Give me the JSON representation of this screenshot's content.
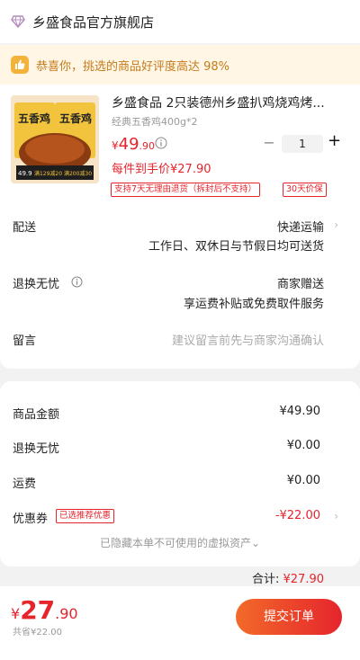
{
  "store": {
    "name": "乡盛食品官方旗舰店"
  },
  "banner": {
    "text": "恭喜你，挑选的商品好评度高达 98%"
  },
  "product": {
    "title": "乡盛食品 2只装德州乡盛扒鸡烧鸡烤...",
    "spec": "经典五香鸡400g*2",
    "price_symbol": "¥",
    "price_int": "49",
    "price_dec": ".90",
    "quantity": "1",
    "unit_price": "每件到手价¥27.90",
    "tags": [
      "支持7天无理由退货（拆封后不支持）",
      "30天价保"
    ],
    "image_text": {
      "left": "五香鸡",
      "right": "五香鸡",
      "promo": "满129减20 满200减30",
      "price": "49.9"
    }
  },
  "delivery": {
    "label": "配送",
    "method": "快递运输",
    "detail": "工作日、双休日与节假日均可送货"
  },
  "return": {
    "label": "退换无忧",
    "value": "商家赠送",
    "detail": "享运费补贴或免费取件服务"
  },
  "remark": {
    "label": "留言",
    "placeholder": "建议留言前先与商家沟通确认"
  },
  "summary": {
    "rows": [
      {
        "label": "商品金额",
        "value": "¥49.90"
      },
      {
        "label": "退换无忧",
        "value": "¥0.00"
      },
      {
        "label": "运费",
        "value": "¥0.00"
      }
    ],
    "coupon": {
      "label": "优惠券",
      "tag": "已选推荐优惠",
      "value": "-¥22.00"
    },
    "hidden_note": "已隐藏本单不可使用的虚拟资产",
    "total_label": "合计:",
    "total_value": "¥27.90"
  },
  "bottom": {
    "price_symbol": "¥",
    "price_int": "27",
    "price_dec": ".90",
    "saved": "共省¥22.00",
    "submit": "提交订单"
  }
}
